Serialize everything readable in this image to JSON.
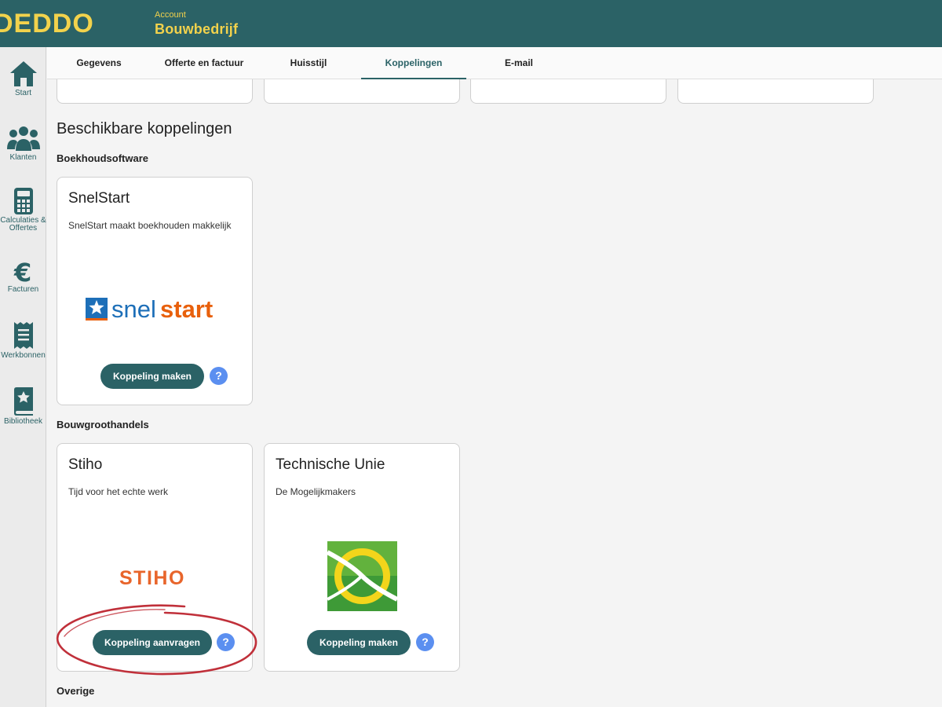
{
  "brand": {
    "logo_text": "DEDDO",
    "account_caption": "Account",
    "account_name": "Bouwbedrijf",
    "accent_color": "#2b6266",
    "brand_yellow": "#f2d24c"
  },
  "sidebar": {
    "items": [
      {
        "label": "Start",
        "icon": "home-icon"
      },
      {
        "label": "Klanten",
        "icon": "users-icon"
      },
      {
        "label": "Calculaties &",
        "label2": "Offertes",
        "icon": "calculator-icon"
      },
      {
        "label": "Facturen",
        "icon": "euro-icon"
      },
      {
        "label": "Werkbonnen",
        "icon": "receipt-icon"
      },
      {
        "label": "Bibliotheek",
        "icon": "library-icon"
      }
    ]
  },
  "tabs": [
    {
      "label": "Gegevens"
    },
    {
      "label": "Offerte en factuur"
    },
    {
      "label": "Huisstijl"
    },
    {
      "label": "Koppelingen",
      "active": true
    },
    {
      "label": "E-mail"
    }
  ],
  "main": {
    "section_title": "Beschikbare koppelingen",
    "groups": [
      {
        "title": "Boekhoudsoftware",
        "cards": [
          {
            "title": "SnelStart",
            "description": "SnelStart maakt boekhouden makkelijk",
            "logo_text_a": "snel",
            "logo_text_b": "start",
            "button": "Koppeling maken",
            "help": "?"
          }
        ]
      },
      {
        "title": "Bouwgroothandels",
        "cards": [
          {
            "title": "Stiho",
            "description": "Tijd voor het echte werk",
            "logo_text": "STIHO",
            "button": "Koppeling aanvragen",
            "help": "?"
          },
          {
            "title": "Technische Unie",
            "description": "De Mogelijkmakers",
            "button": "Koppeling maken",
            "help": "?"
          }
        ]
      },
      {
        "title": "Overige",
        "cards": []
      }
    ]
  }
}
